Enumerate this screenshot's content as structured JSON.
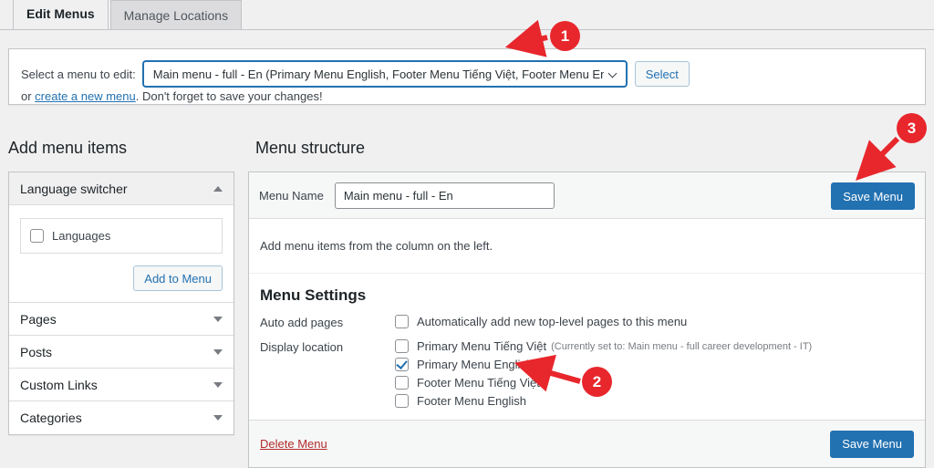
{
  "tabs": [
    {
      "label": "Edit Menus",
      "active": true
    },
    {
      "label": "Manage Locations",
      "active": false
    }
  ],
  "select_strip": {
    "label": "Select a menu to edit:",
    "selected_menu": "Main menu - full - En (Primary Menu English, Footer Menu Tiếng Việt, Footer Menu English)",
    "chevron_icon": "chevron-down-icon",
    "select_button": "Select",
    "create_prefix": "or ",
    "create_link": "create a new menu",
    "create_suffix": ". Don't forget to save your changes!"
  },
  "left_column": {
    "title": "Add menu items",
    "panels": [
      {
        "label": "Language switcher",
        "open": true,
        "toggle_icon": "arrow-up-icon",
        "items": [
          {
            "label": "Languages",
            "checked": false
          }
        ],
        "add_button": "Add to Menu"
      },
      {
        "label": "Pages",
        "open": false,
        "toggle_icon": "arrow-down-icon"
      },
      {
        "label": "Posts",
        "open": false,
        "toggle_icon": "arrow-down-icon"
      },
      {
        "label": "Custom Links",
        "open": false,
        "toggle_icon": "arrow-down-icon"
      },
      {
        "label": "Categories",
        "open": false,
        "toggle_icon": "arrow-down-icon"
      }
    ]
  },
  "right_column": {
    "title": "Menu structure",
    "menu_name_label": "Menu Name",
    "menu_name_value": "Main menu - full - En",
    "menu_name_placeholder": "Menu Name",
    "empty_hint": "Add menu items from the column on the left.",
    "save_menu_top": "Save Menu",
    "settings": {
      "heading": "Menu Settings",
      "auto_add_label": "Auto add pages",
      "auto_add_option": {
        "label": "Automatically add new top-level pages to this menu",
        "checked": false
      },
      "display_location_label": "Display location",
      "locations": [
        {
          "label": "Primary Menu Tiếng Việt",
          "note": "(Currently set to: Main menu - full career development - IT)",
          "checked": false
        },
        {
          "label": "Primary Menu English",
          "note": "",
          "checked": true
        },
        {
          "label": "Footer Menu Tiếng Việt",
          "note": "",
          "checked": false
        },
        {
          "label": "Footer Menu English",
          "note": "",
          "checked": false
        }
      ]
    },
    "delete_menu": "Delete Menu",
    "save_menu_bottom": "Save Menu"
  },
  "annotations": {
    "accent_color": "#e8272c",
    "markers": [
      {
        "id": "1",
        "label": "1",
        "points_to": "menu-select-dropdown"
      },
      {
        "id": "2",
        "label": "2",
        "points_to": "location-checkbox-primary-menu-english"
      },
      {
        "id": "3",
        "label": "3",
        "points_to": "save-menu-button-top"
      }
    ]
  },
  "theme": {
    "primary": "#2271b1",
    "danger": "#b32d2e",
    "page_bg": "#f0f0f1"
  }
}
